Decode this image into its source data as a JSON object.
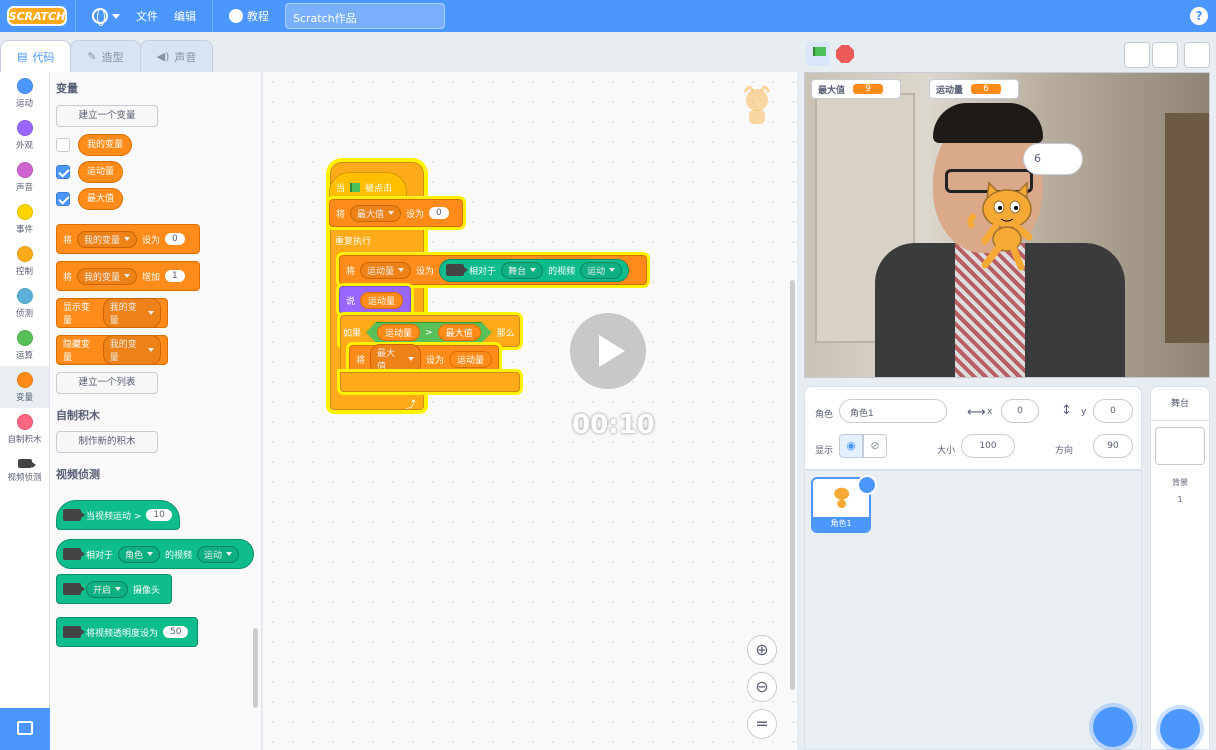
{
  "menu": {
    "logo": "SCRATCH",
    "file": "文件",
    "edit": "编辑",
    "tutorials": "教程",
    "project_title": "Scratch作品",
    "help": "?"
  },
  "tabs": {
    "code": "代码",
    "costumes": "造型",
    "sounds": "声音"
  },
  "categories": [
    {
      "label": "运动",
      "color": "#4c97ff"
    },
    {
      "label": "外观",
      "color": "#9966ff"
    },
    {
      "label": "声音",
      "color": "#cf63cf"
    },
    {
      "label": "事件",
      "color": "#ffd500"
    },
    {
      "label": "控制",
      "color": "#ffab19"
    },
    {
      "label": "侦测",
      "color": "#5cb1d6"
    },
    {
      "label": "运算",
      "color": "#59c059"
    },
    {
      "label": "变量",
      "color": "#ff8c1a"
    },
    {
      "label": "自制积木",
      "color": "#ff6680"
    },
    {
      "label": "视频侦测",
      "color": "#0fbd8c"
    }
  ],
  "palette": {
    "variables_heading": "变量",
    "make_variable": "建立一个变量",
    "vars": [
      "我的变量",
      "运动量",
      "最大值"
    ],
    "set_block": {
      "w1": "将",
      "var": "我的变量",
      "w2": "设为",
      "val": "0"
    },
    "change_block": {
      "w1": "将",
      "var": "我的变量",
      "w2": "增加",
      "val": "1"
    },
    "show_block": {
      "w1": "显示变量",
      "var": "我的变量"
    },
    "hide_block": {
      "w1": "隐藏变量",
      "var": "我的变量"
    },
    "make_list": "建立一个列表",
    "myblocks_heading": "自制积木",
    "make_block": "制作新的积木",
    "video_heading": "视频侦测",
    "when_motion": {
      "w1": "当视频运动 >",
      "val": "10"
    },
    "video_on": {
      "w1": "相对于",
      "dd1": "角色",
      "w2": "的视频",
      "dd2": "运动"
    },
    "turn_video": {
      "dd": "开启",
      "w": "摄像头"
    },
    "set_transparency": {
      "w": "将视频透明度设为",
      "val": "50"
    }
  },
  "script": {
    "hat": {
      "w1": "当",
      "w2": "被点击"
    },
    "set_max": {
      "w1": "将",
      "var": "最大值",
      "w2": "设为",
      "val": "0"
    },
    "forever": "重复执行",
    "set_motion": {
      "w1": "将",
      "var": "运动量",
      "w2": "设为",
      "w3": "相对于",
      "dd1": "舞台",
      "w4": "的视频",
      "dd2": "运动"
    },
    "say": {
      "w": "说",
      "var": "运动量"
    },
    "if_block": {
      "w1": "如果",
      "a": "运动量",
      "op": ">",
      "b": "最大值",
      "w2": "那么"
    },
    "set_max2": {
      "w1": "将",
      "var": "最大值",
      "w2": "设为",
      "val": "运动量"
    }
  },
  "video_timer": "00:10",
  "monitors": [
    {
      "label": "最大值",
      "value": "9"
    },
    {
      "label": "运动量",
      "value": "6"
    }
  ],
  "speech": "6",
  "sprite_info": {
    "sprite_label": "角色",
    "sprite_name": "角色1",
    "x_label": "x",
    "x": "0",
    "y_label": "y",
    "y": "0",
    "show_label": "显示",
    "size_label": "大小",
    "size": "100",
    "dir_label": "方向",
    "dir": "90"
  },
  "sprite_list": [
    {
      "name": "角色1"
    }
  ],
  "stage_panel": {
    "title": "舞台",
    "backdrop_label": "背景",
    "backdrop_count": "1"
  }
}
